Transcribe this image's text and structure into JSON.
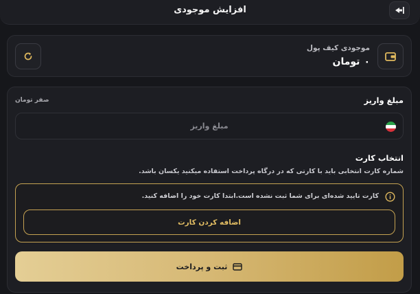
{
  "header": {
    "title": "افزایش موجودی",
    "back_icon": "exit-arrow-icon"
  },
  "wallet": {
    "label": "موجودی کیف پول",
    "amount": "۰",
    "currency": "تومان",
    "icon": "wallet-icon",
    "refresh_icon": "refresh-icon"
  },
  "deposit": {
    "title": "مبلغ واریز",
    "hint": "صفر تومان",
    "input_placeholder": "مبلغ واریز",
    "input_value": "",
    "flag_icon": "iran-flag-icon"
  },
  "card_select": {
    "title": "انتخاب کارت",
    "description": "شماره کارت انتخابی باید با کارتی که در درگاه پرداخت استفاده میکنید یکسان باشد.",
    "warning_text": "کارت تایید شده‌ای برای شما ثبت نشده است.ابتدا کارت خود را اضافه کنید.",
    "warning_icon": "info-icon",
    "add_card_label": "اضافه کردن کارت"
  },
  "pay": {
    "label": "ثبت و پرداخت",
    "icon": "credit-card-icon"
  },
  "colors": {
    "accent": "#c6a352",
    "background": "#16171b",
    "card": "#1d1e23"
  }
}
